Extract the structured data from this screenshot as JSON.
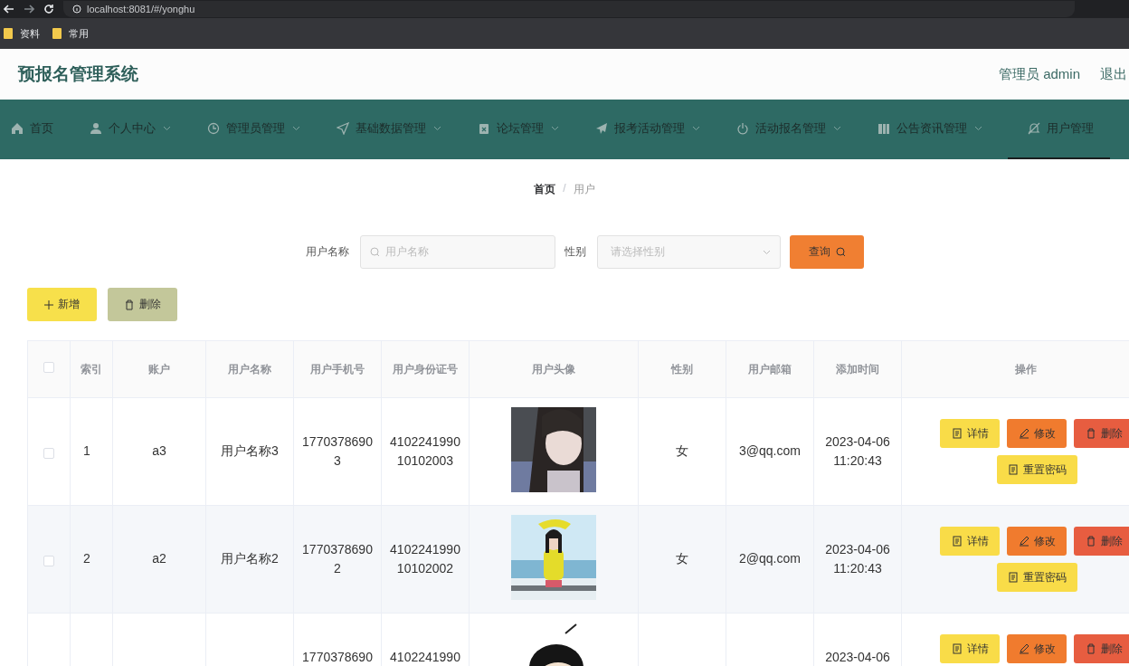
{
  "browser": {
    "url": "localhost:8081/#/yonghu",
    "bookmarks": [
      "资料",
      "常用"
    ]
  },
  "header": {
    "title": "预报名管理系统",
    "user": "管理员 admin",
    "logout": "退出"
  },
  "nav": {
    "items": [
      {
        "label": "首页",
        "dropdown": false,
        "selected": false
      },
      {
        "label": "个人中心",
        "dropdown": true,
        "selected": false
      },
      {
        "label": "管理员管理",
        "dropdown": true,
        "selected": false
      },
      {
        "label": "基础数据管理",
        "dropdown": true,
        "selected": false
      },
      {
        "label": "论坛管理",
        "dropdown": true,
        "selected": false
      },
      {
        "label": "报考活动管理",
        "dropdown": true,
        "selected": false
      },
      {
        "label": "活动报名管理",
        "dropdown": true,
        "selected": false
      },
      {
        "label": "公告资讯管理",
        "dropdown": true,
        "selected": false
      },
      {
        "label": "用户管理",
        "dropdown": false,
        "selected": true
      }
    ]
  },
  "breadcrumb": {
    "items": [
      "首页",
      "用户"
    ],
    "separator": "/"
  },
  "search": {
    "name_label": "用户名称",
    "name_placeholder": "用户名称",
    "gender_label": "性别",
    "gender_placeholder": "请选择性别",
    "button": "查询"
  },
  "toolbar": [
    {
      "kind": "add",
      "label": "新增"
    },
    {
      "kind": "delete",
      "label": "删除"
    }
  ],
  "table": {
    "select_all": {
      "checked": false
    },
    "columns": [
      "索引",
      "账户",
      "用户名称",
      "用户手机号",
      "用户身份证号",
      "用户头像",
      "性别",
      "用户邮箱",
      "添加时间",
      "操作"
    ],
    "rows": [
      {
        "checked": false,
        "index": "1",
        "account": "a3",
        "name": "用户名称3",
        "phone": "17703786903",
        "idcard": "410224199010102003",
        "avatar": {
          "kind": "picture"
        },
        "gender": "女",
        "email": "3@qq.com",
        "time": "2023-04-06 11:20:43",
        "actions": [
          {
            "kind": "detail",
            "label": "详情"
          },
          {
            "kind": "edit",
            "label": "修改"
          },
          {
            "kind": "delete",
            "label": "删除"
          },
          {
            "kind": "reset",
            "label": "重置密码"
          }
        ]
      },
      {
        "checked": false,
        "index": "2",
        "account": "a2",
        "name": "用户名称2",
        "phone": "17703786902",
        "idcard": "410224199010102002",
        "avatar": {
          "kind": "picture"
        },
        "gender": "女",
        "email": "2@qq.com",
        "time": "2023-04-06 11:20:43",
        "actions": [
          {
            "kind": "detail",
            "label": "详情"
          },
          {
            "kind": "edit",
            "label": "修改"
          },
          {
            "kind": "delete",
            "label": "删除"
          },
          {
            "kind": "reset",
            "label": "重置密码"
          }
        ]
      },
      {
        "phone": "1770378690",
        "idcard": "4102241990",
        "avatar": {
          "kind": "picture"
        },
        "time": "2023-04-06",
        "actions": [
          {
            "kind": "detail",
            "label": "详情"
          },
          {
            "kind": "edit",
            "label": "修改"
          },
          {
            "kind": "delete",
            "label": "删除"
          }
        ]
      }
    ]
  }
}
